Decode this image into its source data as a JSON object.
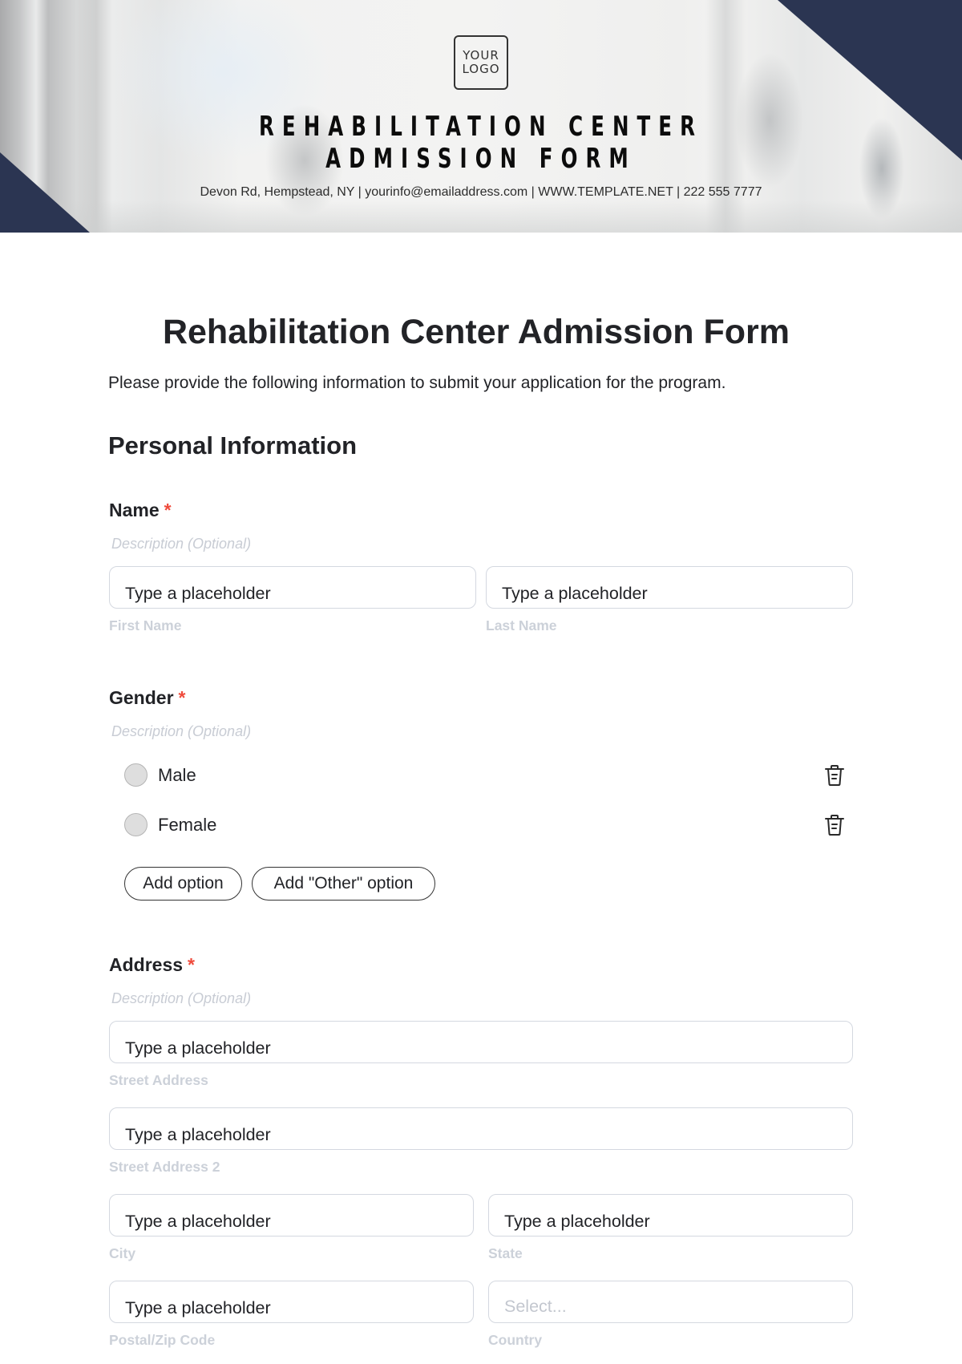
{
  "header": {
    "logo_line1": "YOUR",
    "logo_line2": "LOGO",
    "title_line1": "REHABILITATION CENTER",
    "title_line2": "ADMISSION FORM",
    "contact": "Devon Rd, Hempstead, NY | yourinfo@emailaddress.com | WWW.TEMPLATE.NET | 222 555 7777",
    "accent_color": "#2b3552"
  },
  "form": {
    "title": "Rehabilitation Center Admission Form",
    "intro": "Please provide the following information to submit your application for the program.",
    "section_title": "Personal Information",
    "required_marker": "*",
    "required_color": "#ef4b3c",
    "questions": {
      "name": {
        "label": "Name",
        "description": "Description (Optional)",
        "fields": [
          {
            "value": "Type a placeholder",
            "sublabel": "First Name"
          },
          {
            "value": "Type a placeholder",
            "sublabel": "Last Name"
          }
        ]
      },
      "gender": {
        "label": "Gender",
        "description": "Description (Optional)",
        "options": [
          {
            "label": "Male",
            "selected": false
          },
          {
            "label": "Female",
            "selected": false
          }
        ],
        "add_option_label": "Add option",
        "add_other_label": "Add \"Other\" option"
      },
      "address": {
        "label": "Address",
        "description": "Description (Optional)",
        "fields": [
          {
            "value": "Type a placeholder",
            "sublabel": "Street Address"
          },
          {
            "value": "Type a placeholder",
            "sublabel": "Street Address 2"
          },
          {
            "value": "Type a placeholder",
            "sublabel": "City"
          },
          {
            "value": "Type a placeholder",
            "sublabel": "State"
          },
          {
            "value": "Type a placeholder",
            "sublabel": "Postal/Zip Code"
          },
          {
            "placeholder": "Select...",
            "sublabel": "Country"
          }
        ]
      }
    }
  }
}
